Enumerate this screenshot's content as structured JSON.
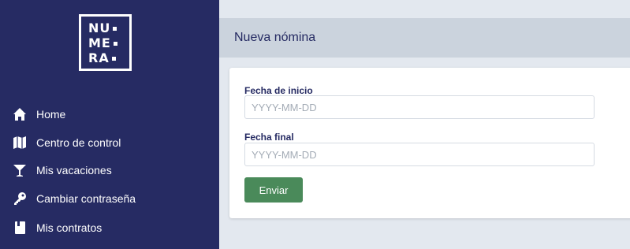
{
  "logo": {
    "rows": [
      "NU",
      "ME",
      "RA"
    ]
  },
  "sidebar": {
    "items": [
      {
        "label": "Home",
        "icon": "home-icon"
      },
      {
        "label": "Centro de control",
        "icon": "map-icon"
      },
      {
        "label": "Mis vacaciones",
        "icon": "cocktail-icon"
      },
      {
        "label": "Cambiar contraseña",
        "icon": "key-icon"
      },
      {
        "label": "Mis contratos",
        "icon": "contract-icon"
      }
    ]
  },
  "header": {
    "title": "Nueva nómina"
  },
  "form": {
    "start_date": {
      "label": "Fecha de inicio",
      "placeholder": "YYYY-MM-DD",
      "value": ""
    },
    "end_date": {
      "label": "Fecha final",
      "placeholder": "YYYY-MM-DD",
      "value": ""
    },
    "submit_label": "Enviar"
  },
  "colors": {
    "sidebar": "#262b63",
    "topbar": "#cbd3dd",
    "background": "#e3e8ef",
    "button": "#4a8a5a"
  }
}
